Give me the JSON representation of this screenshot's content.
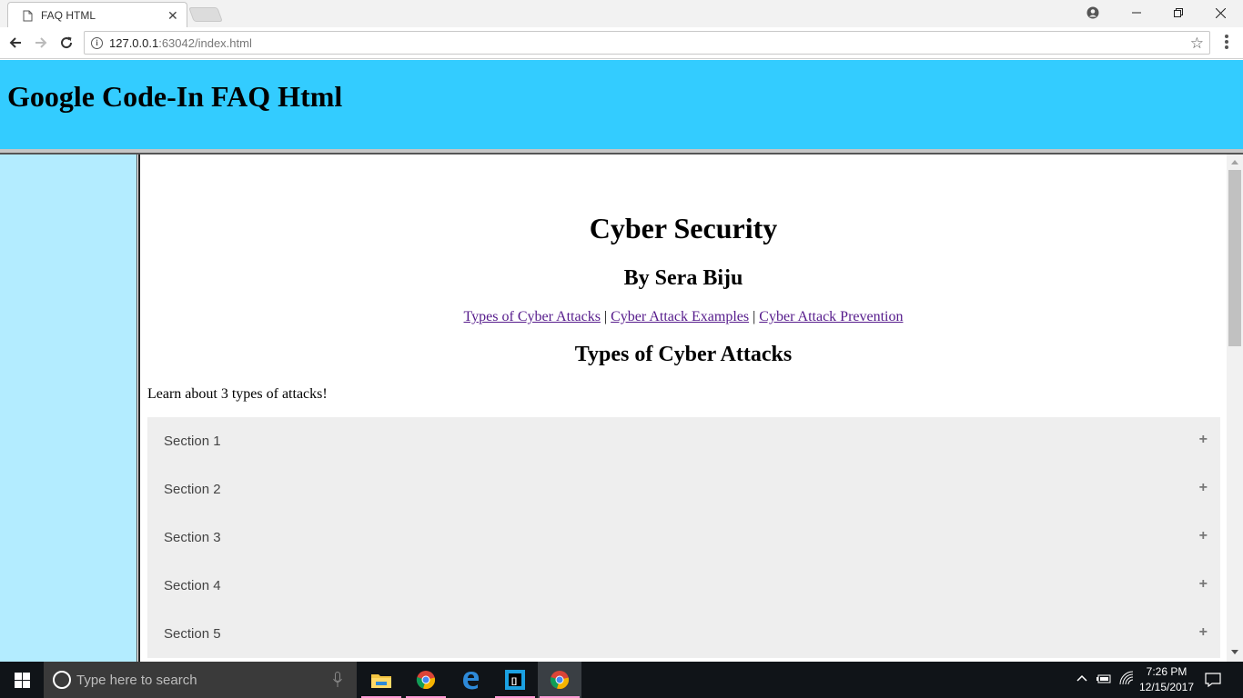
{
  "browser": {
    "tab_title": "FAQ HTML",
    "url_host": "127.0.0.1",
    "url_rest": ":63042/index.html"
  },
  "header": {
    "title": "Google Code-In FAQ Html",
    "background": "#33ccff"
  },
  "sidebar": {
    "background": "#b3ecff"
  },
  "content": {
    "title": "Cyber Security",
    "author": "By Sera Biju",
    "links": [
      "Types of Cyber Attacks",
      "Cyber Attack Examples",
      "Cyber Attack Prevention"
    ],
    "link_separator": "|",
    "section_heading": "Types of Cyber Attacks",
    "intro": "Learn about 3 types of attacks!",
    "accordion": [
      {
        "label": "Section 1",
        "toggle": "+"
      },
      {
        "label": "Section 2",
        "toggle": "+"
      },
      {
        "label": "Section 3",
        "toggle": "+"
      },
      {
        "label": "Section 4",
        "toggle": "+"
      },
      {
        "label": "Section 5",
        "toggle": "+"
      }
    ]
  },
  "taskbar": {
    "search_placeholder": "Type here to search",
    "time": "7:26 PM",
    "date": "12/15/2017"
  }
}
